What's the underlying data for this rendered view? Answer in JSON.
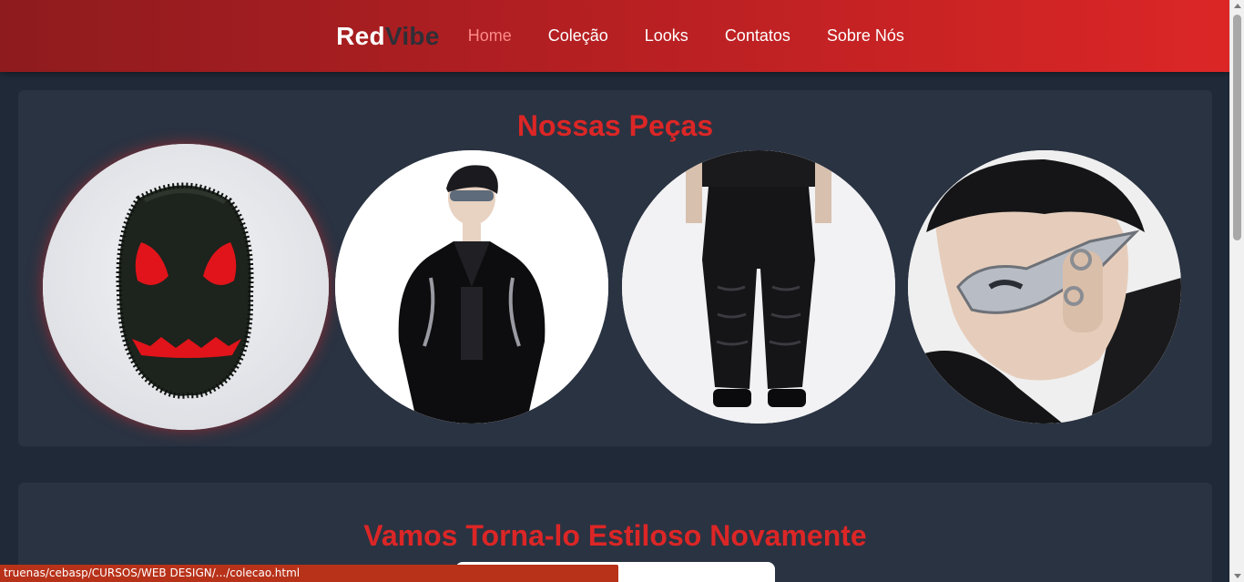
{
  "header": {
    "logo": {
      "part1": "Red",
      "part2": "Vibe"
    },
    "nav": [
      {
        "label": "Home",
        "active": true
      },
      {
        "label": "Coleção",
        "active": false
      },
      {
        "label": "Looks",
        "active": false
      },
      {
        "label": "Contatos",
        "active": false
      },
      {
        "label": "Sobre Nós",
        "active": false
      }
    ]
  },
  "sections": {
    "pieces": {
      "title": "Nossas Peças",
      "items": [
        {
          "image": "furry-black-mask-with-red-eyes",
          "highlighted": true
        },
        {
          "image": "model-black-patent-leather-jacket-sunglasses"
        },
        {
          "image": "black-stacked-leather-pants"
        },
        {
          "image": "model-silver-spiked-sunglasses-rings"
        }
      ]
    },
    "style": {
      "title": "Vamos Torna-lo Estiloso Novamente"
    }
  },
  "status_bar": {
    "url": "truenas/cebasp/CURSOS/WEB DESIGN/.../colecao.html"
  },
  "colors": {
    "brand_red": "#dc2626",
    "header_gradient_start": "#8e1b1e",
    "header_gradient_end": "#dc2626",
    "page_bg": "#1f2937",
    "card_bg": "#2a3342",
    "nav_active": "#ff8a8a",
    "status_bar_bg": "#b8321a"
  }
}
